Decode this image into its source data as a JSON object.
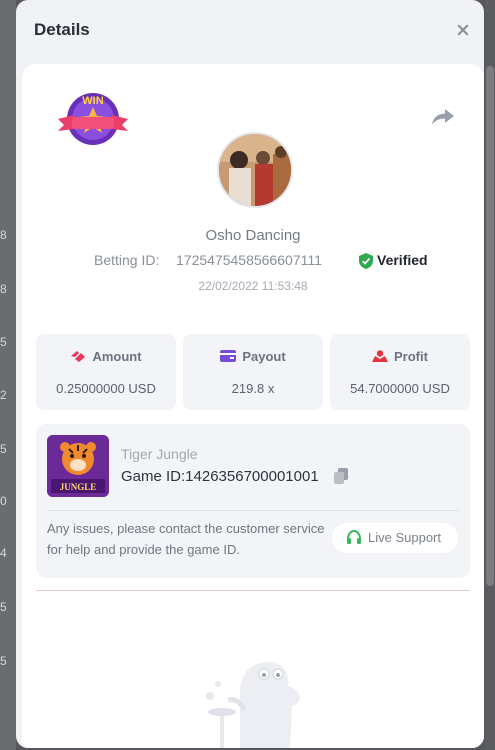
{
  "modal": {
    "title": "Details"
  },
  "bet": {
    "user_name": "Osho Dancing",
    "betting_id_label": "Betting ID:",
    "betting_id": "1725475458566607111",
    "verified_label": "Verified",
    "datetime": "22/02/2022 11:53:48",
    "badge_text": "WIN"
  },
  "stats": {
    "amount": {
      "label": "Amount",
      "value": "0.25000000 USD"
    },
    "payout": {
      "label": "Payout",
      "value": "219.8 x"
    },
    "profit": {
      "label": "Profit",
      "value": "54.7000000 USD"
    }
  },
  "game": {
    "name": "Tiger Jungle",
    "id_text": "Game ID:1426356700001001",
    "thumb_label": "JUNGLE",
    "issue_text": "Any issues, please contact the customer service for help and provide the game ID.",
    "support_label": "Live Support"
  },
  "background_digits": [
    "8",
    "8",
    "5",
    "2",
    "5",
    "0",
    "4",
    "5",
    "5"
  ],
  "colors": {
    "verified": "#2fa84f",
    "amount_icon": "#e8395a",
    "payout_icon": "#7a4dd8",
    "profit_icon": "#e0353f",
    "support_icon": "#3ab55b"
  }
}
